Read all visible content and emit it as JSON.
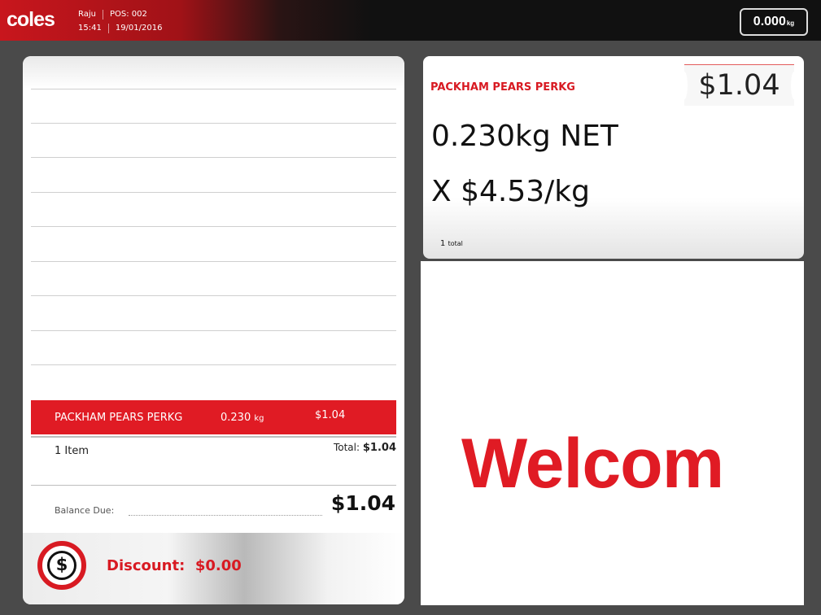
{
  "header": {
    "brand": "coles",
    "cashier": "Raju",
    "pos": "POS: 002",
    "time": "15:41",
    "date": "19/01/2016",
    "scale_weight": "0.000",
    "scale_unit": "kg"
  },
  "transaction": {
    "lines": [
      {
        "name": "PACKHAM PEARS PERKG",
        "weight": "0.230",
        "unit": "kg",
        "price": "$1.04"
      }
    ],
    "item_count": "1 Item",
    "total_label": "Total:",
    "total_value": "$1.04",
    "balance_label": "Balance Due:",
    "balance_value": "$1.04"
  },
  "discount": {
    "icon_symbol": "$",
    "label": "Discount:",
    "value": "$0.00"
  },
  "product_display": {
    "name": "PACKHAM PEARS PERKG",
    "price": "$1.04",
    "weight_text": "0.230kg NET",
    "rate_text": "X $4.53/kg",
    "count": "1",
    "count_label": "total"
  },
  "welcome": {
    "text": "Welcom"
  },
  "colors": {
    "brand_red": "#e01b24",
    "header_dark": "#111111",
    "panel_bg": "#ffffff",
    "app_bg": "#4a4a4a"
  }
}
